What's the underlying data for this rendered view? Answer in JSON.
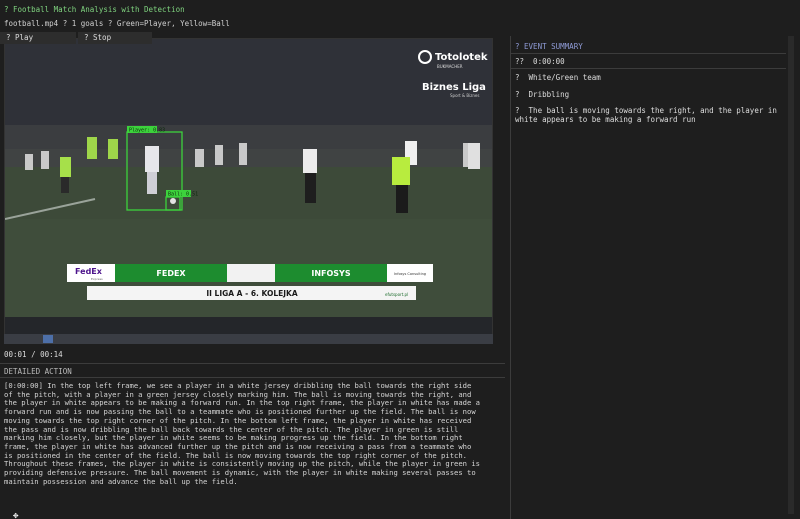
{
  "app": {
    "title": "? Football Match Analysis with Detection",
    "subtitle": "football.mp4 ? 1 goals ? Green=Player, Yellow=Ball"
  },
  "video": {
    "sponsor_logo": "Totolotek",
    "sponsor_sub": "BUKMACHER",
    "league_logo": "Biznes Liga",
    "league_logo_sub": "Sport & Biznes",
    "board_brand": "FedEx",
    "board_brand_sub": "Express",
    "team_left": "FEDEX",
    "team_right": "INFOSYS",
    "board_right_brand": "Infosys Consulting",
    "league_name": "II LIGA A - 6. KOLEJKA",
    "board_bottom_right": "efutsport.pl",
    "detections": [
      {
        "label": "Player: 0.83",
        "color": "#3cd23c"
      },
      {
        "label": "Ball: 0.51",
        "color": "#3cd23c"
      }
    ]
  },
  "controls": {
    "play_label": "? Play",
    "stop_label": "? Stop",
    "time": "00:01 / 00:14",
    "progress": 0.08
  },
  "detailed_action": {
    "label": "DETAILED ACTION",
    "text": "[0:00:00] In the top left frame, we see a player in a white jersey dribbling the ball towards the right side of the pitch, with a player in a green jersey closely marking him. The ball is moving towards the right, and the player in white appears to be making a forward run. In the top right frame, the player in white has made a forward run and is now passing the ball to a teammate who is positioned further up the field. The ball is now moving towards the top right corner of the pitch. In the bottom left frame, the player in white has received the pass and is now dribbling the ball back towards the center of the pitch. The player in green is still marking him closely, but the player in white seems to be making progress up the field. In the bottom right frame, the player in white has advanced further up the pitch and is now receiving a pass from a teammate who is positioned in the center of the field. The ball is now moving towards the top right corner of the pitch. Throughout these frames, the player in white is consistently moving up the pitch, while the player in green is providing defensive pressure. The ball movement is dynamic, with the player in white making several passes to maintain possession and advance the ball up the field."
  },
  "event_summary": {
    "label": "? EVENT SUMMARY",
    "time": "??  0:00:00",
    "team": "?  White/Green team",
    "action": "?  Dribbling",
    "description": "?  The ball is moving towards the right, and the player in white appears to be making a forward run"
  }
}
